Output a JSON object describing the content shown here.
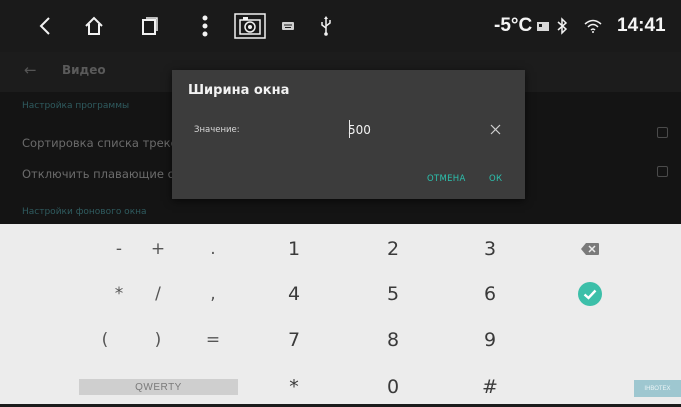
{
  "status_bar": {
    "temperature": "-5°C",
    "time": "14:41",
    "icons": [
      "back-icon",
      "home-icon",
      "recents-icon",
      "menu-icon",
      "camera-icon",
      "keyboard-icon",
      "usb-icon",
      "sim-icon",
      "bluetooth-icon",
      "wifi-icon"
    ]
  },
  "app": {
    "title": "Видео",
    "section_program": "Настройка программы",
    "row_sort": "Сортировка списка треков",
    "row_floating": "Отключить плавающие окна",
    "section_background": "Настройки фонового окна"
  },
  "dialog": {
    "title": "Ширина окна",
    "field_label": "Значение:",
    "field_value": "500",
    "cancel_label": "ОТМЕНА",
    "ok_label": "ОК"
  },
  "keypad": {
    "row1": [
      "-",
      "+",
      ".",
      "1",
      "2",
      "3"
    ],
    "row2": [
      "*",
      "/",
      ",",
      "4",
      "5",
      "6"
    ],
    "row3": [
      "(",
      ")",
      "=",
      "7",
      "8",
      "9"
    ],
    "row4": [
      "*",
      "0",
      "#"
    ],
    "mode_label": "QWERTY",
    "accent_color": "#3cbfa9"
  },
  "watermark": "ІНВОТЕХ"
}
